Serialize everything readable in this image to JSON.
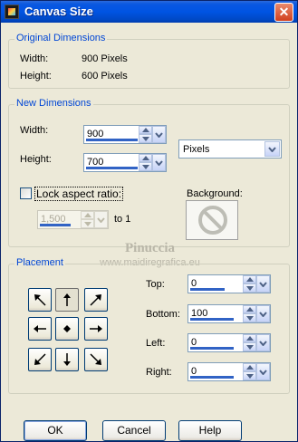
{
  "window": {
    "title": "Canvas Size",
    "close_glyph": "✕"
  },
  "original": {
    "legend": "Original Dimensions",
    "width_label": "Width:",
    "width_value": "900 Pixels",
    "height_label": "Height:",
    "height_value": "600 Pixels"
  },
  "new_dims": {
    "legend": "New Dimensions",
    "width_label": "Width:",
    "width_value": "900",
    "height_label": "Height:",
    "height_value": "700",
    "unit": "Pixels",
    "lock_label": "Lock aspect ratio:",
    "lock_checked": false,
    "ratio_value": "1,500",
    "ratio_suffix": "to 1",
    "background_label": "Background:"
  },
  "placement": {
    "legend": "Placement",
    "selected": "top-center",
    "top_label": "Top:",
    "top_value": "0",
    "bottom_label": "Bottom:",
    "bottom_value": "100",
    "left_label": "Left:",
    "left_value": "0",
    "right_label": "Right:",
    "right_value": "0"
  },
  "buttons": {
    "ok": "OK",
    "cancel": "Cancel",
    "help": "Help"
  },
  "watermark": {
    "line1": "Pinuccia",
    "line2": "www.maidiregrafica.eu"
  },
  "colors": {
    "legend_blue": "#0046d5",
    "titlebar": "#0054e3",
    "spin_bar": "#3163c5"
  }
}
